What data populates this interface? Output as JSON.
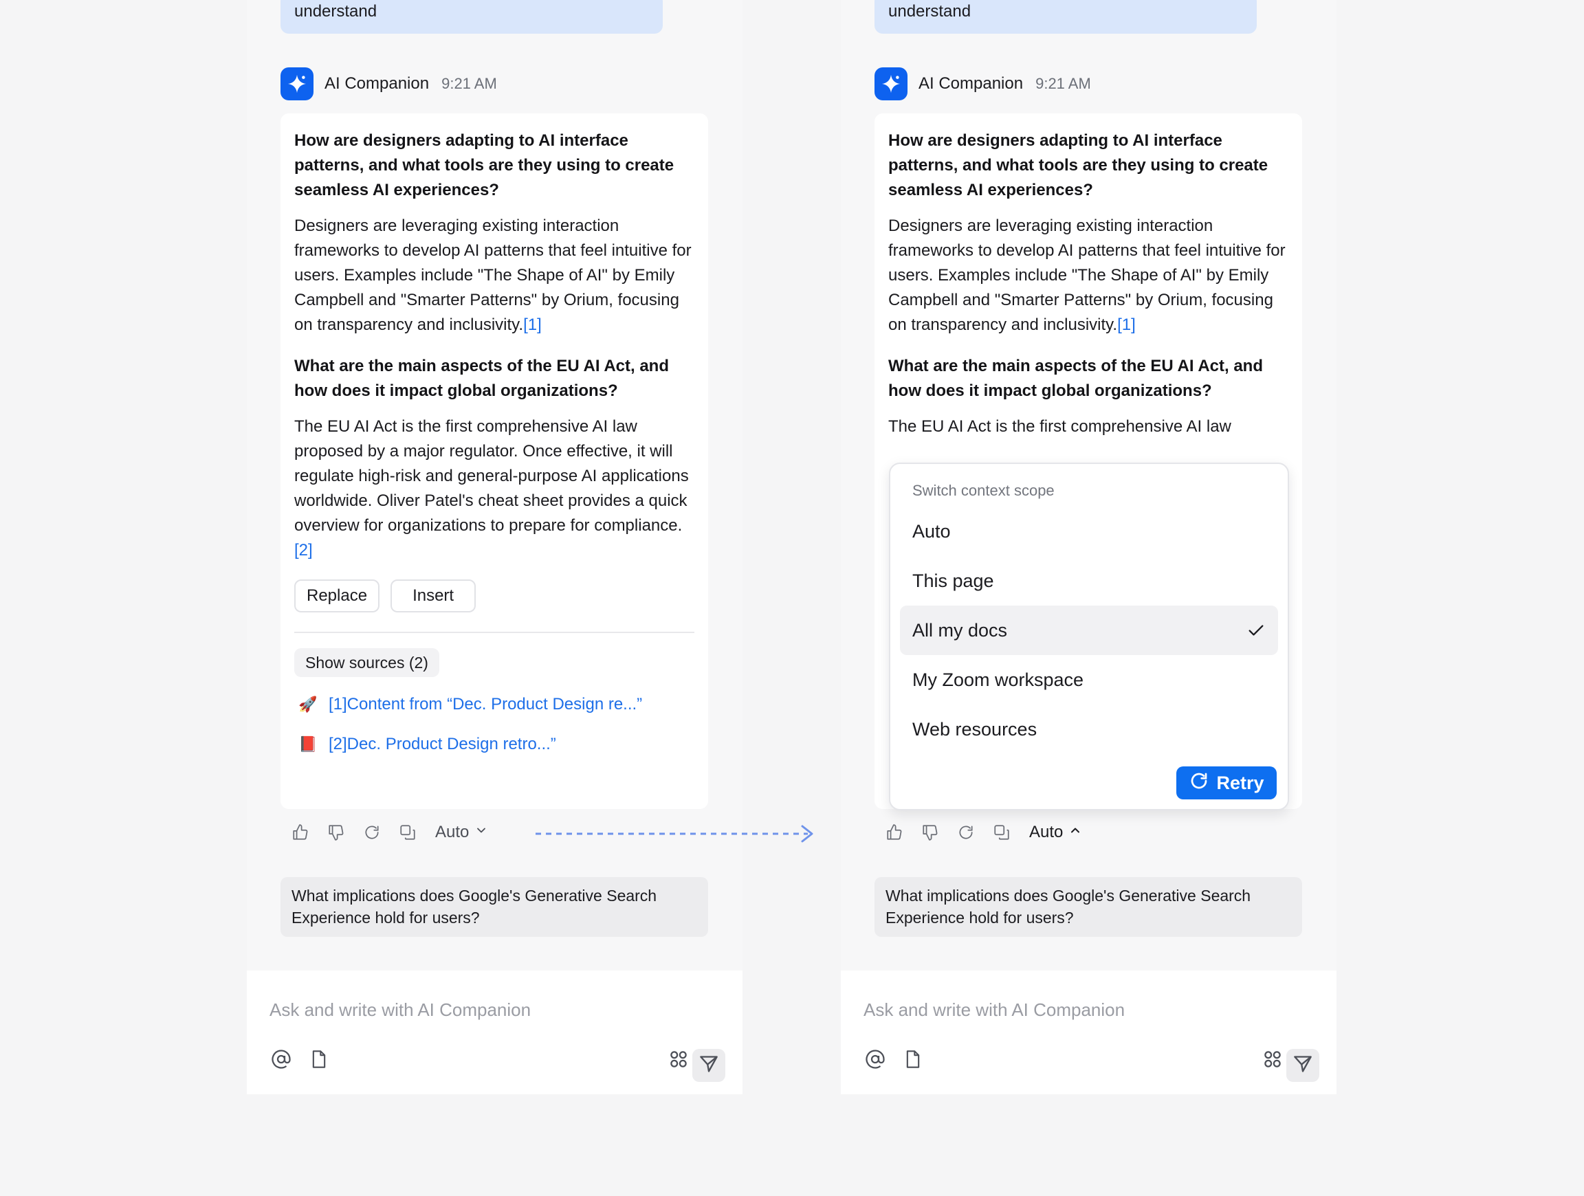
{
  "colors": {
    "accent": "#0e62ef",
    "link": "#1e6fe8",
    "user_bubble": "#d9e6fb",
    "connector": "#6f93ea"
  },
  "user_message_tail": "understand",
  "assistant": {
    "name": "AI Companion",
    "time": "9:21 AM",
    "avatar_icon": "sparkle-icon"
  },
  "answer": {
    "q1": "How are designers adapting to AI interface patterns, and what tools are they using to create seamless AI experiences?",
    "a1": "Designers are leveraging existing interaction frameworks to develop AI patterns that feel intuitive for users. Examples include \"The Shape of AI\" by Emily Campbell and \"Smarter Patterns\" by Orium, focusing on transparency and inclusivity.",
    "a1_cite": "[1]",
    "q2": "What are the main aspects of the EU AI Act, and how does it impact global organizations?",
    "a2": "The EU AI Act is the first comprehensive AI law proposed by a major regulator. Once effective, it will regulate high-risk and general-purpose AI applications worldwide. Oliver Patel's cheat sheet provides a quick overview for organizations to prepare for compliance.",
    "a2_visible_right": "The EU AI Act is the first comprehensive AI law",
    "a2_cite": "[2]"
  },
  "card_actions": {
    "replace": "Replace",
    "insert": "Insert"
  },
  "sources": {
    "toggle": "Show sources (2)",
    "items": [
      {
        "emoji": "🚀",
        "text": "[1]Content from “Dec. Product Design re...”"
      },
      {
        "emoji": "📕",
        "text": "[2]Dec. Product Design retro...”"
      }
    ]
  },
  "toolbar": {
    "icons": [
      "thumbs-up-icon",
      "thumbs-down-icon",
      "regenerate-icon",
      "copy-icon"
    ],
    "scope_label": "Auto"
  },
  "suggestion": "What implications does Google's Generative Search Experience hold for users?",
  "composer": {
    "placeholder": "Ask and write with AI Companion",
    "icons": [
      "at-mention-icon",
      "document-icon",
      "apps-icon",
      "send-icon"
    ]
  },
  "scope_menu": {
    "title": "Switch context scope",
    "options": [
      "Auto",
      "This page",
      "All my docs",
      "My Zoom workspace",
      "Web resources"
    ],
    "selected": "All my docs",
    "retry_label": "Retry"
  }
}
